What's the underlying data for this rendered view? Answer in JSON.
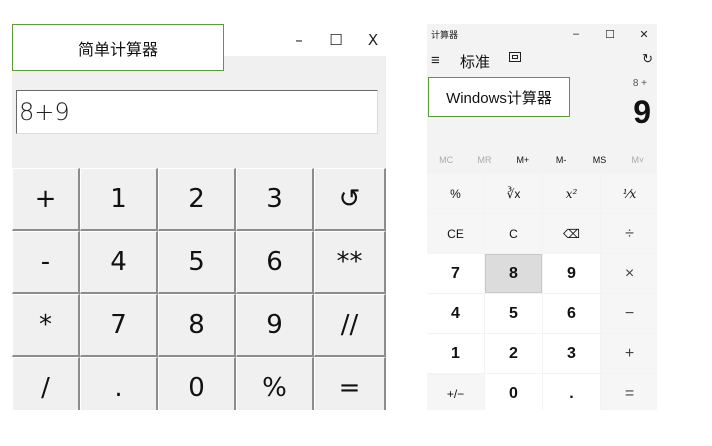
{
  "simple": {
    "title": "简单计算器",
    "controls": {
      "minimize": "–",
      "maximize": "☐",
      "close": "X"
    },
    "display_value": "8+9",
    "keys": [
      "+",
      "1",
      "2",
      "3",
      "↺",
      "-",
      "4",
      "5",
      "6",
      "**",
      "*",
      "7",
      "8",
      "9",
      "//",
      "/",
      ".",
      "0",
      "%",
      "="
    ]
  },
  "wincalc": {
    "window_title": "计算器",
    "controls": {
      "minimize": "–",
      "maximize": "☐",
      "close": "✕"
    },
    "menu_icon": "≡",
    "mode": "标准",
    "keep_on_top_icon": "keep-on-top-icon",
    "history_icon": "↻",
    "label": "Windows计算器",
    "expression": "8 +",
    "result": "9",
    "memory": [
      {
        "label": "MC",
        "enabled": false
      },
      {
        "label": "MR",
        "enabled": false
      },
      {
        "label": "M+",
        "enabled": true
      },
      {
        "label": "M-",
        "enabled": true
      },
      {
        "label": "MS",
        "enabled": true
      },
      {
        "label": "M˅",
        "enabled": false
      }
    ],
    "keys": [
      "%",
      "∛x",
      "x²",
      "⅟x",
      "CE",
      "C",
      "⌫",
      "÷",
      "7",
      "8",
      "9",
      "×",
      "4",
      "5",
      "6",
      "−",
      "1",
      "2",
      "3",
      "+",
      "+/−",
      "0",
      ".",
      "="
    ]
  }
}
